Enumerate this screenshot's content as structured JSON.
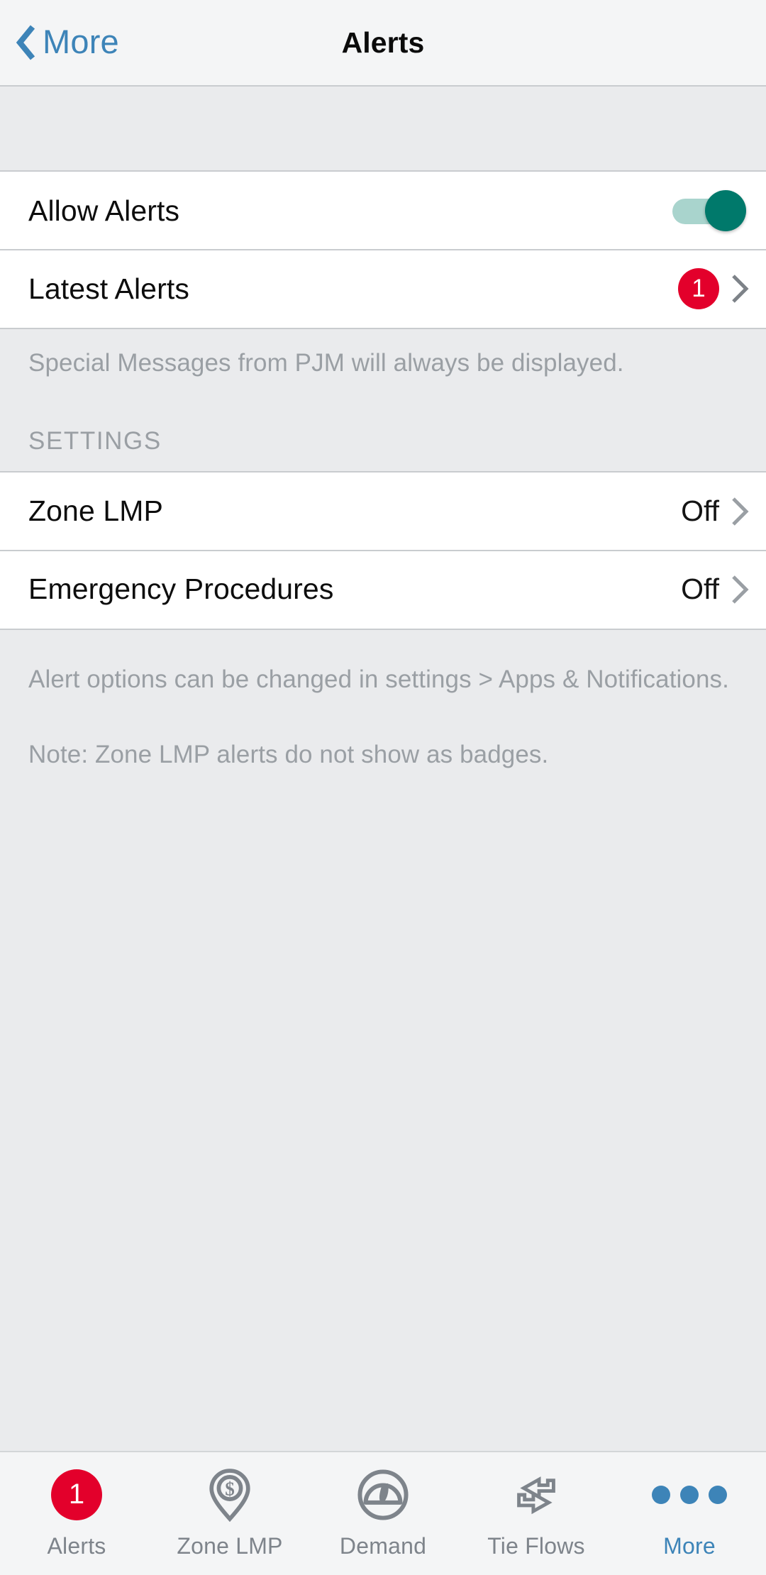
{
  "header": {
    "back_label": "More",
    "back_icon": "chevron-left-icon",
    "title": "Alerts"
  },
  "colors": {
    "accent_blue": "#3d84b8",
    "badge_red": "#e3002b",
    "switch_on_thumb": "#00796b",
    "switch_on_track": "#a9d4cd",
    "page_background": "#eaebed",
    "row_background": "#ffffff",
    "muted_text": "#9a9fa4",
    "separator": "#c9cccf"
  },
  "main": {
    "group_one": {
      "allow_alerts": {
        "label": "Allow Alerts",
        "control": "toggle-switch",
        "state": "on"
      },
      "latest_alerts": {
        "label": "Latest Alerts",
        "badge": "1",
        "accessory": "chevron-right-icon"
      }
    },
    "note_special_messages": "Special Messages from PJM will always be displayed.",
    "settings_section_header": "SETTINGS",
    "settings_rows": [
      {
        "label": "Zone LMP",
        "value": "Off",
        "accessory": "chevron-right-icon"
      },
      {
        "label": "Emergency Procedures",
        "value": "Off",
        "accessory": "chevron-right-icon"
      }
    ],
    "footnote_options": "Alert options can be changed in settings > Apps & Notifications.",
    "footnote_note": "Note: Zone LMP alerts do not show as badges."
  },
  "tabbar": {
    "items": [
      {
        "label": "Alerts",
        "icon": "alert-badge-icon",
        "badge": "1",
        "active": false
      },
      {
        "label": "Zone LMP",
        "icon": "map-pin-dollar-icon",
        "active": false
      },
      {
        "label": "Demand",
        "icon": "gauge-icon",
        "active": false
      },
      {
        "label": "Tie Flows",
        "icon": "exchange-arrows-icon",
        "active": false
      },
      {
        "label": "More",
        "icon": "three-dots-icon",
        "active": true
      }
    ]
  }
}
